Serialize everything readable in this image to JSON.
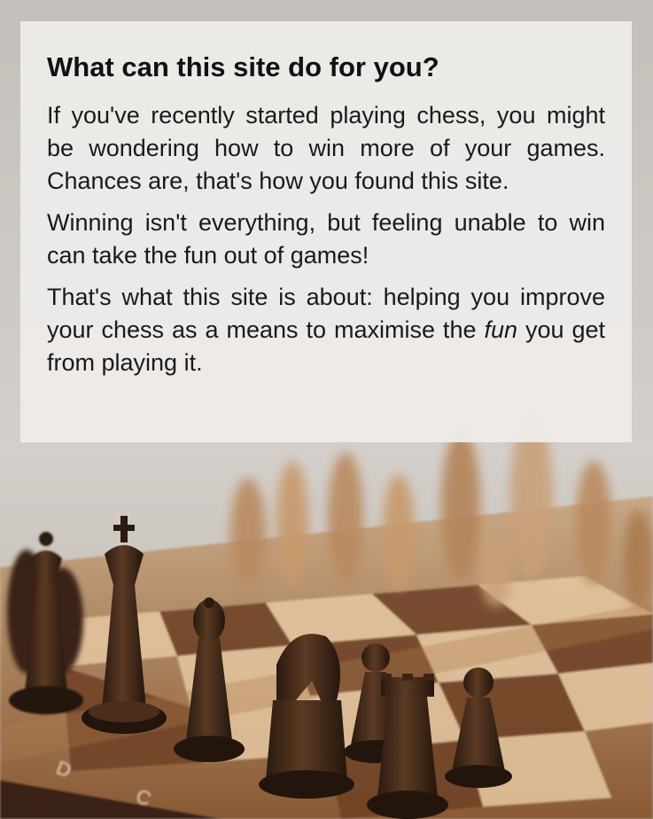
{
  "info_card": {
    "heading": "What can this site do for you?",
    "paragraph_1": "If you've recently started playing chess, you might be wondering how to win more of your games. Chances are, that's how you found this site.",
    "paragraph_2": "Winning isn't everything, but feeling unable to win can take the fun out of games!",
    "paragraph_3_start": "That's what this site is about: helping you improve your chess as a means to maximise the ",
    "paragraph_3_emphasis": "fun",
    "paragraph_3_end": " you get from playing it."
  },
  "background": {
    "description_icon": "chessboard-photo",
    "board_square_labels": [
      "D",
      "C"
    ]
  },
  "colors": {
    "card_bg": "#eeecea",
    "text": "#111111",
    "wood_dark": "#5a3a22",
    "wood_light": "#d9b48a"
  }
}
